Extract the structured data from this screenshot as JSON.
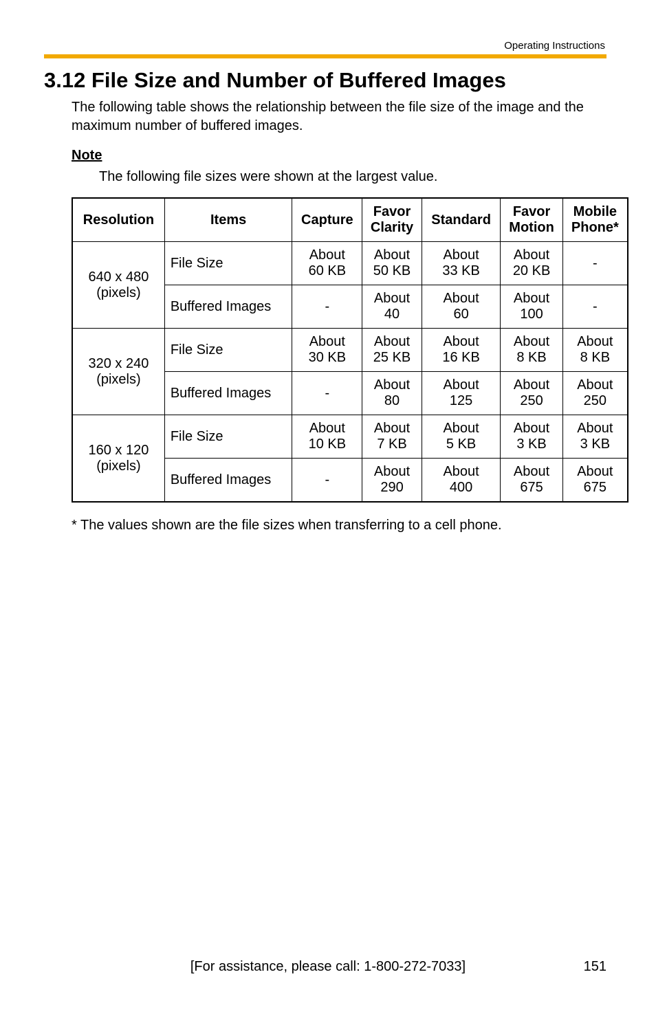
{
  "header": {
    "running_head": "Operating Instructions"
  },
  "title": "3.12  File Size and Number of Buffered Images",
  "intro": "The following table shows the relationship between the file size of the image and the maximum number of buffered images.",
  "note": {
    "heading": "Note",
    "text": "The following file sizes were shown at the largest value."
  },
  "table": {
    "headers": [
      "Resolution",
      "Items",
      "Capture",
      "Favor Clarity",
      "Standard",
      "Favor Motion",
      "Mobile Phone*"
    ],
    "groups": [
      {
        "resolution": "640 x 480 (pixels)",
        "rows": [
          {
            "item": "File Size",
            "capture": "About 60 KB",
            "clarity": "About 50 KB",
            "standard": "About 33 KB",
            "motion": "About 20 KB",
            "mobile": "-"
          },
          {
            "item": "Buffered Images",
            "capture": "-",
            "clarity": "About 40",
            "standard": "About 60",
            "motion": "About 100",
            "mobile": "-"
          }
        ]
      },
      {
        "resolution": "320 x 240 (pixels)",
        "rows": [
          {
            "item": "File Size",
            "capture": "About 30 KB",
            "clarity": "About 25 KB",
            "standard": "About 16 KB",
            "motion": "About 8 KB",
            "mobile": "About 8 KB"
          },
          {
            "item": "Buffered Images",
            "capture": "-",
            "clarity": "About 80",
            "standard": "About 125",
            "motion": "About 250",
            "mobile": "About 250"
          }
        ]
      },
      {
        "resolution": "160 x 120 (pixels)",
        "rows": [
          {
            "item": "File Size",
            "capture": "About 10 KB",
            "clarity": "About 7 KB",
            "standard": "About 5 KB",
            "motion": "About 3 KB",
            "mobile": "About 3 KB"
          },
          {
            "item": "Buffered Images",
            "capture": "-",
            "clarity": "About 290",
            "standard": "About 400",
            "motion": "About 675",
            "mobile": "About 675"
          }
        ]
      }
    ]
  },
  "footnote": "*  The values shown are the file sizes when transferring to a cell phone.",
  "footer": {
    "assist": "[For assistance, please call: 1-800-272-7033]",
    "page": "151"
  }
}
